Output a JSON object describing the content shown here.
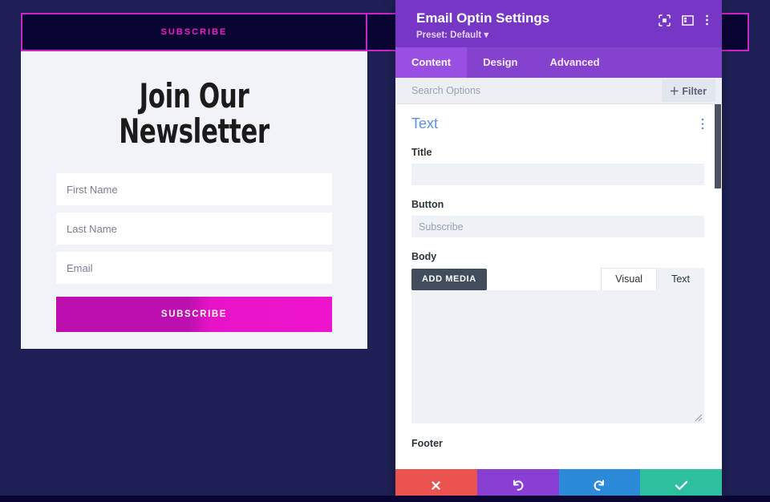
{
  "preview": {
    "header_label": "SUBSCRIBE",
    "title": "Join Our Newsletter",
    "fields": [
      {
        "placeholder": "First Name"
      },
      {
        "placeholder": "Last Name"
      },
      {
        "placeholder": "Email"
      }
    ],
    "submit_label": "SUBSCRIBE",
    "colors": {
      "header_bg": "#0a0433",
      "header_text": "#e920c4",
      "outline": "#cc24c7",
      "body_bg": "#f1f3f8",
      "button_from": "#bd0fb0",
      "button_to": "#ec14cd",
      "page_bg": "#1d2055"
    }
  },
  "panel": {
    "title": "Email Optin Settings",
    "preset": "Preset: Default ▾",
    "header_icons": [
      {
        "name": "focus-module-icon"
      },
      {
        "name": "layout-panel-icon"
      },
      {
        "name": "more-options-icon"
      }
    ],
    "tabs": [
      {
        "label": "Content",
        "active": true
      },
      {
        "label": "Design",
        "active": false
      },
      {
        "label": "Advanced",
        "active": false
      }
    ],
    "search": {
      "placeholder": "Search Options",
      "value": ""
    },
    "filter_button": "＋ Filter",
    "section": {
      "title": "Text",
      "kebab": "section-options-icon"
    },
    "fields": [
      {
        "label": "Title",
        "value": "",
        "placeholder": ""
      },
      {
        "label": "Button",
        "value": "",
        "placeholder": "Subscribe"
      }
    ],
    "body_field": {
      "label": "Body",
      "add_media_label": "ADD MEDIA",
      "editor_tabs": [
        {
          "label": "Visual",
          "active": false
        },
        {
          "label": "Text",
          "active": true
        }
      ],
      "content": ""
    },
    "footer_field": {
      "label": "Footer"
    },
    "actions": [
      {
        "name": "cancel-button",
        "glyph": "✖",
        "color": "#e9544f"
      },
      {
        "name": "undo-button",
        "glyph": "↺",
        "color": "#8a3fd4"
      },
      {
        "name": "redo-button",
        "glyph": "↻",
        "color": "#2d8ad8"
      },
      {
        "name": "save-button",
        "glyph": "✔",
        "color": "#2ebf9f"
      }
    ],
    "colors": {
      "header_bg": "#7638c4",
      "tabbar_bg": "#8542cf",
      "tab_active_bg": "#9a4fe3",
      "section_title": "#5f8ee8",
      "input_bg": "#eef1f6",
      "add_media_bg": "#414d5c"
    }
  }
}
